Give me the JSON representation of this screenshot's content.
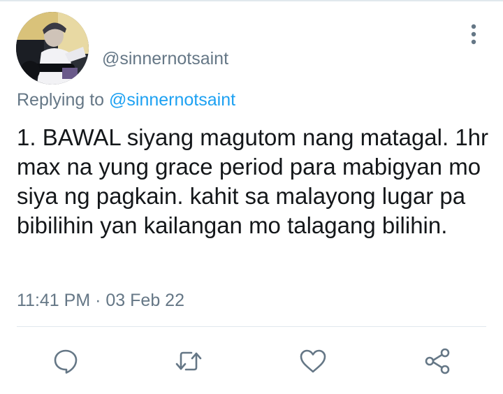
{
  "tweet": {
    "author_handle": "@sinnernotsaint",
    "replying_prefix": "Replying to",
    "replying_to": "@sinnernotsaint",
    "text": "1. BAWAL siyang magutom nang matagal. 1hr max na yung grace period para mabigyan mo siya ng pagkain. kahit sa malayong lugar pa bibilihin yan kailangan mo talagang bilihin.",
    "time": "11:41 PM",
    "separator": "·",
    "date": "03 Feb 22"
  },
  "actions": [
    {
      "icon": "reply-icon"
    },
    {
      "icon": "retweet-icon"
    },
    {
      "icon": "like-icon"
    },
    {
      "icon": "share-icon"
    }
  ],
  "menu": {
    "icon": "more-vertical-icon"
  },
  "colors": {
    "text": "#14171a",
    "secondary": "#657786",
    "link": "#1da1f2",
    "divider": "#e1e8ed"
  }
}
